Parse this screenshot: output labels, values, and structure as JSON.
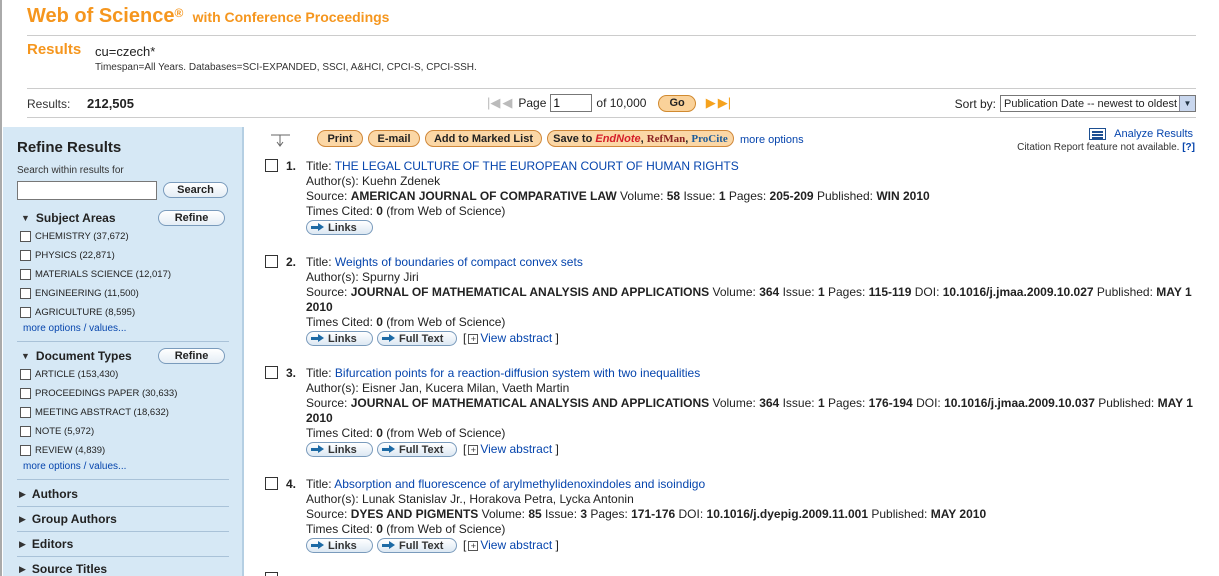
{
  "header": {
    "brand": "Web of Science",
    "reg": "®",
    "subtitle": "with Conference Proceedings",
    "results_title": "Results",
    "query": "cu=czech*",
    "timespan": "Timespan=All Years. Databases=SCI-EXPANDED, SSCI, A&HCI, CPCI-S, CPCI-SSH."
  },
  "results_bar": {
    "results_label": "Results:",
    "results_count": "212,505",
    "page_label": "Page",
    "page_value": "1",
    "of_label": "of 10,000",
    "go_label": "Go",
    "sort_label": "Sort by:",
    "sort_value": "Publication Date -- newest to oldest"
  },
  "sidebar": {
    "title": "Refine Results",
    "search_hint": "Search within results for",
    "search_button": "Search",
    "refine_label": "Refine",
    "subject_areas": {
      "title": "Subject Areas",
      "items": [
        "CHEMISTRY (37,672)",
        "PHYSICS (22,871)",
        "MATERIALS SCIENCE (12,017)",
        "ENGINEERING (11,500)",
        "AGRICULTURE (8,595)"
      ],
      "more": "more options / values..."
    },
    "document_types": {
      "title": "Document Types",
      "items": [
        "ARTICLE (153,430)",
        "PROCEEDINGS PAPER (30,633)",
        "MEETING ABSTRACT (18,632)",
        "NOTE (5,972)",
        "REVIEW (4,839)"
      ],
      "more": "more options / values..."
    },
    "collapsed": [
      "Authors",
      "Group Authors",
      "Editors",
      "Source Titles"
    ]
  },
  "toolbar": {
    "print": "Print",
    "email": "E-mail",
    "marked": "Add to Marked List",
    "save_prefix": "Save to",
    "endnote": "EndNote",
    "refman": "RefMan",
    "procite": "ProCite",
    "more_options": "more options",
    "analyze": "Analyze Results",
    "cite_note": "Citation Report feature not available.",
    "help": "[?]"
  },
  "labels": {
    "title": "Title:",
    "authors": "Author(s):",
    "source": "Source:",
    "volume": "Volume:",
    "issue": "Issue:",
    "pages": "Pages:",
    "doi": "DOI:",
    "published": "Published:",
    "times_cited": "Times Cited:",
    "from_wos": "(from Web of Science)",
    "links": "Links",
    "full_text": "Full Text",
    "view_abstract": "View abstract",
    "plus": "+",
    "lbr": "[",
    "rbr": "]"
  },
  "records": [
    {
      "num": "1.",
      "title": "THE LEGAL CULTURE OF THE EUROPEAN COURT OF HUMAN RIGHTS",
      "authors": "Kuehn Zdenek",
      "source": "AMERICAN JOURNAL OF COMPARATIVE LAW",
      "volume": "58",
      "issue": "1",
      "pages": "205-209",
      "doi": "",
      "published": "WIN 2010",
      "times_cited": "0"
    },
    {
      "num": "2.",
      "title": "Weights of boundaries of compact convex sets",
      "authors": "Spurny Jiri",
      "source": "JOURNAL OF MATHEMATICAL ANALYSIS AND APPLICATIONS",
      "volume": "364",
      "issue": "1",
      "pages": "115-119",
      "doi": "10.1016/j.jmaa.2009.10.027",
      "published": "MAY 1 2010",
      "times_cited": "0"
    },
    {
      "num": "3.",
      "title": "Bifurcation points for a reaction-diffusion system with two inequalities",
      "authors": "Eisner Jan, Kucera Milan, Vaeth Martin",
      "source": "JOURNAL OF MATHEMATICAL ANALYSIS AND APPLICATIONS",
      "volume": "364",
      "issue": "1",
      "pages": "176-194",
      "doi": "10.1016/j.jmaa.2009.10.037",
      "published": "MAY 1 2010",
      "times_cited": "0"
    },
    {
      "num": "4.",
      "title": "Absorption and fluorescence of arylmethylidenoxindoles and isoindigo",
      "authors": "Lunak Stanislav Jr., Horakova Petra, Lycka Antonin",
      "source": "DYES AND PIGMENTS",
      "volume": "85",
      "issue": "3",
      "pages": "171-176",
      "doi": "10.1016/j.dyepig.2009.11.001",
      "published": "MAY 2010",
      "times_cited": "0"
    }
  ]
}
